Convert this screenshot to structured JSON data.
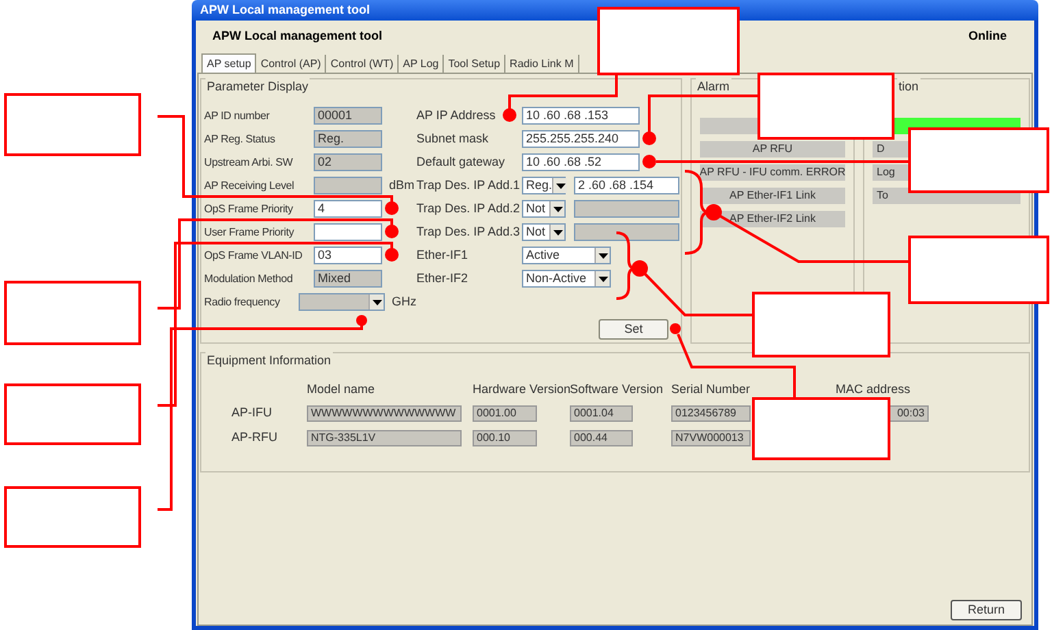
{
  "window": {
    "title": "APW Local management tool"
  },
  "header": {
    "title": "APW Local management tool",
    "status": "Online"
  },
  "tabs": [
    {
      "label": "AP setup",
      "selected": true
    },
    {
      "label": "Control  (AP)",
      "selected": false
    },
    {
      "label": "Control  (WT)",
      "selected": false
    },
    {
      "label": "AP Log",
      "selected": false
    },
    {
      "label": "Tool Setup",
      "selected": false
    },
    {
      "label": "Radio Link M",
      "selected": false
    }
  ],
  "parameter_display": {
    "title": "Parameter Display",
    "left": [
      {
        "label": "AP ID number",
        "kind": "field",
        "value": "00001",
        "editable": false
      },
      {
        "label": "AP Reg. Status",
        "kind": "field",
        "value": "Reg.",
        "editable": false
      },
      {
        "label": "Upstream Arbi. SW",
        "kind": "field",
        "value": "02",
        "editable": false
      },
      {
        "label": "AP Receiving Level",
        "kind": "field",
        "editable": false,
        "unit": "dBm"
      },
      {
        "label": "OpS Frame Priority",
        "kind": "field",
        "value": "4",
        "editable": true
      },
      {
        "label": "User Frame Priority",
        "kind": "field",
        "editable": true
      },
      {
        "label": "OpS Frame VLAN-ID",
        "kind": "field",
        "value": "03",
        "editable": true
      },
      {
        "label": "Modulation Method",
        "kind": "field",
        "value": "Mixed",
        "editable": false
      },
      {
        "label": "Radio frequency",
        "kind": "dropdown",
        "disabled": true,
        "unit": "GHz"
      }
    ],
    "right": [
      {
        "label": "AP IP Address",
        "kind": "field",
        "value": "10 .60 .68 .153",
        "editable": true
      },
      {
        "label": "Subnet mask",
        "kind": "field",
        "value": "255.255.255.240",
        "editable": true
      },
      {
        "label": "Default gateway",
        "kind": "field",
        "value": "10 .60 .68 .52",
        "editable": true
      },
      {
        "label": "Trap Des. IP Add.1",
        "kind": "combo",
        "select": "Reg.",
        "value": "2 .60 .68 .154",
        "editable": true
      },
      {
        "label": "Trap Des. IP Add.2",
        "kind": "combo",
        "select": "Not",
        "editable": false
      },
      {
        "label": "Trap Des. IP Add.3",
        "kind": "combo",
        "select": "Not",
        "editable": false
      },
      {
        "label": "Ether-IF1",
        "kind": "dropdown",
        "select": "Active"
      },
      {
        "label": "Ether-IF2",
        "kind": "dropdown",
        "select": "Non-Active"
      }
    ],
    "button": "Set"
  },
  "alarm": {
    "title": "Alarm",
    "items": [
      {
        "kind": "blank"
      },
      {
        "kind": "text",
        "label": "AP RFU"
      },
      {
        "kind": "text",
        "label": "AP RFU - IFU comm. ERROR"
      },
      {
        "kind": "text",
        "label": "AP Ether-IF1 Link"
      },
      {
        "kind": "text",
        "label": "AP Ether-IF2 Link"
      }
    ]
  },
  "right_group": {
    "title": "tion",
    "items": [
      {
        "lit": true
      },
      {
        "label": "D",
        "lit": false
      },
      {
        "label": "Log",
        "lit": false
      },
      {
        "label": "To",
        "lit": false
      }
    ]
  },
  "equipment": {
    "title": "Equipment Information",
    "columns": [
      "Model name",
      "Hardware Version",
      "Software Version",
      "Serial Number",
      "MAC address"
    ],
    "rows": [
      {
        "label": "AP-IFU",
        "cells": [
          "WWWWWWWWWWWWWW",
          "0001.00",
          "0001.04",
          "0123456789",
          "00:03"
        ]
      },
      {
        "label": "AP-RFU",
        "cells": [
          "NTG-335L1V",
          "000.10",
          "000.44",
          "N7VW000013",
          ""
        ]
      }
    ]
  },
  "footer": {
    "button": "Return"
  }
}
